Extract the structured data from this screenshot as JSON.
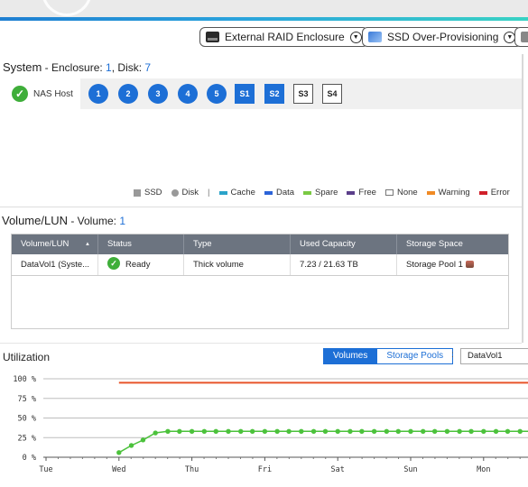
{
  "toolbar": {
    "external_raid_label": "External RAID Enclosure",
    "ssd_overprov_label": "SSD Over-Provisioning"
  },
  "system": {
    "title": "System",
    "enclosure_label": " - Enclosure: ",
    "enclosure_count": "1",
    "disk_label": ", Disk: ",
    "disk_count": "7",
    "host_label": "NAS Host",
    "disks": [
      {
        "label": "1",
        "kind": "hdd"
      },
      {
        "label": "2",
        "kind": "hdd"
      },
      {
        "label": "3",
        "kind": "hdd"
      },
      {
        "label": "4",
        "kind": "hdd"
      },
      {
        "label": "5",
        "kind": "hdd"
      },
      {
        "label": "S1",
        "kind": "ssd"
      },
      {
        "label": "S2",
        "kind": "ssd"
      },
      {
        "label": "S3",
        "kind": "empty"
      },
      {
        "label": "S4",
        "kind": "empty"
      }
    ]
  },
  "legend": {
    "items": [
      {
        "label": "SSD",
        "color": "#999999"
      },
      {
        "label": "Disk",
        "color": "#999999"
      },
      {
        "label": "Cache",
        "color": "#2aa3c9"
      },
      {
        "label": "Data",
        "color": "#2b63d8"
      },
      {
        "label": "Spare",
        "color": "#7ac943"
      },
      {
        "label": "Free",
        "color": "#5b3f8a"
      },
      {
        "label": "None",
        "color": "#ffffff"
      },
      {
        "label": "Warning",
        "color": "#f08a24"
      },
      {
        "label": "Error",
        "color": "#d0202a"
      }
    ]
  },
  "volume": {
    "title": "Volume/LUN",
    "count_label": " - Volume: ",
    "count": "1",
    "columns": [
      "Volume/LUN",
      "Status",
      "Type",
      "Used Capacity",
      "Storage Space"
    ],
    "rows": [
      {
        "name": "DataVol1 (Syste...",
        "status": "Ready",
        "type": "Thick volume",
        "used": "7.23 / 21.63 TB",
        "space": "Storage Pool 1"
      }
    ]
  },
  "utilization": {
    "title": "Utilization",
    "tab_volumes": "Volumes",
    "tab_pools": "Storage Pools",
    "colon": ":",
    "selected_volume": "DataVol1"
  },
  "chart_data": {
    "type": "line",
    "ylim": [
      0,
      100
    ],
    "yticks": [
      "100 %",
      "75 %",
      "50 %",
      "25 %",
      "0 %"
    ],
    "xticks": [
      "Tue",
      "Wed",
      "Thu",
      "Fri",
      "Sat",
      "Sun",
      "Mon"
    ],
    "threshold": {
      "value": 95,
      "color": "#e8542a"
    },
    "series": [
      {
        "color": "#4cc23c",
        "x": [
          1.0,
          1.17,
          1.33,
          1.5,
          1.67,
          1.83,
          2.0,
          2.17,
          2.33,
          2.5,
          2.67,
          2.83,
          3.0,
          3.17,
          3.33,
          3.5,
          3.67,
          3.83,
          4.0,
          4.17,
          4.33,
          4.5,
          4.67,
          4.83,
          5.0,
          5.17,
          5.33,
          5.5,
          5.67,
          5.83,
          6.0,
          6.17,
          6.33,
          6.5,
          6.67,
          6.83,
          7.0
        ],
        "y": [
          6,
          15,
          22,
          31,
          33,
          33,
          33,
          33,
          33,
          33,
          33,
          33,
          33,
          33,
          33,
          33,
          33,
          33,
          33,
          33,
          33,
          33,
          33,
          33,
          33,
          33,
          33,
          33,
          33,
          33,
          33,
          33,
          33,
          33,
          33,
          33,
          33
        ]
      }
    ]
  }
}
